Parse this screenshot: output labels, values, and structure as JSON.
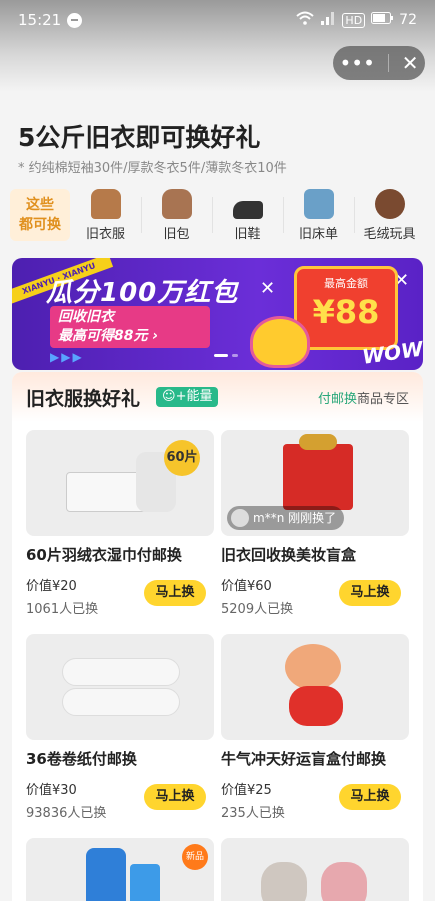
{
  "status_bar": {
    "time": "15:21",
    "battery": "72",
    "hd": "HD"
  },
  "header": {
    "more_icon": "more-icon",
    "close_icon": "close-icon"
  },
  "page": {
    "title": "5公斤旧衣即可换好礼",
    "subtitle": "* 约纯棉短袖30件/厚款冬衣5件/薄款冬衣10件"
  },
  "categories": {
    "lead_line1": "这些",
    "lead_line2": "都可换",
    "items": [
      {
        "label": "旧衣服",
        "icon": "jacket-icon",
        "color": "#b67a4a"
      },
      {
        "label": "旧包",
        "icon": "bag-icon",
        "color": "#a87452"
      },
      {
        "label": "旧鞋",
        "icon": "shoe-icon",
        "color": "#333333"
      },
      {
        "label": "旧床单",
        "icon": "bedsheet-icon",
        "color": "#6aa0c8"
      },
      {
        "label": "毛绒玩具",
        "icon": "teddy-bear-icon",
        "color": "#7a4a30"
      }
    ]
  },
  "banner": {
    "ribbon": "XIANYU · XIANYU",
    "title": "瓜分100万红包",
    "line1": "回收旧衣",
    "line2": "最高可得88元 ›",
    "arrows": "▶▶▶",
    "box_label": "最高金额",
    "box_amount": "¥88",
    "wow": "WOW!"
  },
  "section": {
    "title": "旧衣服换好礼",
    "badge": "+能量",
    "link_green": "付邮换",
    "link_rest": "商品专区"
  },
  "products": [
    {
      "name": "60片羽绒衣湿巾付邮换",
      "price": "价值¥20",
      "count": "1061人已换",
      "button": "马上换",
      "tag": "60片"
    },
    {
      "name": "旧衣回收换美妆盲盒",
      "price": "价值¥60",
      "count": "5209人已换",
      "button": "马上换",
      "ticker": "m**n 刚刚换了"
    },
    {
      "name": "36卷卷纸付邮换",
      "price": "价值¥30",
      "count": "93836人已换",
      "button": "马上换"
    },
    {
      "name": "牛气冲天好运盲盒付邮换",
      "price": "价值¥25",
      "count": "235人已换",
      "button": "马上换"
    },
    {
      "name": "",
      "price": "",
      "count": "",
      "button": "",
      "tag": "新品"
    },
    {
      "name": "",
      "price": "",
      "count": "",
      "button": ""
    }
  ],
  "colors": {
    "accent_yellow": "#ffd52e",
    "green": "#28b98a",
    "banner_purple": "#5a22c6",
    "red": "#f0402f"
  }
}
